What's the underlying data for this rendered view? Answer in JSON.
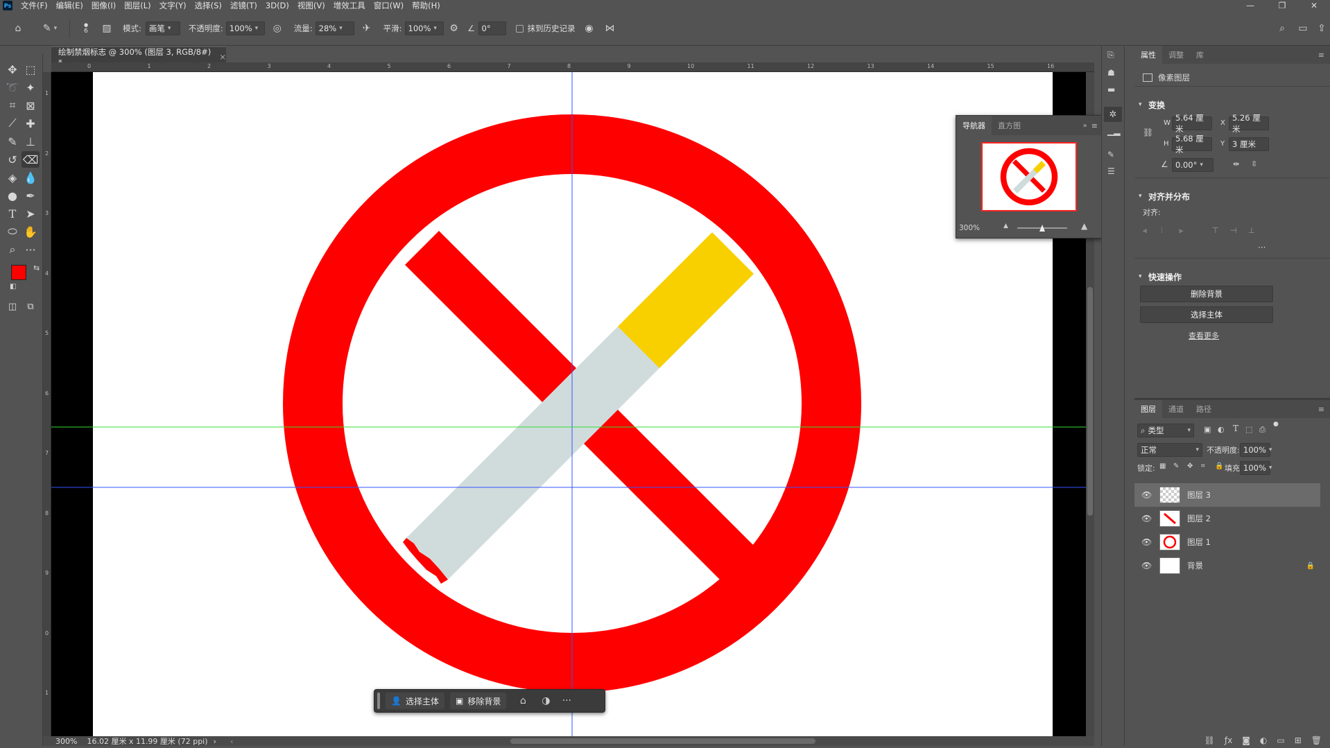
{
  "app": {
    "logo": "Ps"
  },
  "menu": [
    "文件(F)",
    "编辑(E)",
    "图像(I)",
    "图层(L)",
    "文字(Y)",
    "选择(S)",
    "滤镜(T)",
    "3D(D)",
    "视图(V)",
    "增效工具",
    "窗口(W)",
    "帮助(H)"
  ],
  "options": {
    "brush_size": "6",
    "mode_label": "模式:",
    "mode_value": "画笔",
    "opacity_label": "不透明度:",
    "opacity_value": "100%",
    "flow_label": "流量:",
    "flow_value": "28%",
    "smooth_label": "平滑:",
    "smooth_value": "100%",
    "angle_value": "0°",
    "erase_history_label": "抹到历史记录"
  },
  "document": {
    "tab_title": "绘制禁烟标志 @ 300% (图层 3, RGB/8#) *",
    "close_glyph": "×",
    "ruler_top": [
      "0",
      "1",
      "2",
      "3",
      "4",
      "5",
      "6",
      "7",
      "8",
      "9",
      "10",
      "11",
      "12",
      "13",
      "14",
      "15",
      "16"
    ],
    "ruler_left": [
      "1",
      "2",
      "3",
      "4",
      "5",
      "6",
      "7",
      "8",
      "9",
      "0",
      "1"
    ],
    "status_zoom": "300%",
    "status_info": "16.02 厘米 x 11.99 厘米 (72 ppi)",
    "status_arrow": "›"
  },
  "colors": {
    "foreground": "#ff0000",
    "background": "#f8d000",
    "sign_red": "#ff0000",
    "filter_yellow": "#f8d000",
    "cigarette_body": "#d0dcdc",
    "guide_blue": "#3355ff",
    "guide_green": "#33dd33"
  },
  "navigator": {
    "tab_navigator": "导航器",
    "tab_histogram": "直方图",
    "zoom": "300%",
    "zoom_fraction": 0.5
  },
  "context_bar": {
    "select_subject": "选择主体",
    "remove_bg": "移除背景",
    "more": "···"
  },
  "properties": {
    "tabs": [
      "属性",
      "调整",
      "库"
    ],
    "layer_kind": "像素图层",
    "transform_title": "变换",
    "w_label": "W",
    "w_value": "5.64 厘米",
    "x_label": "X",
    "x_value": "5.26 厘米",
    "h_label": "H",
    "h_value": "5.68 厘米",
    "y_label": "Y",
    "y_value": "3 厘米",
    "angle_value": "0.00°",
    "align_title": "对齐并分布",
    "align_label": "对齐:",
    "more_dots": "···",
    "quick_title": "快速操作",
    "remove_bg_btn": "删除背景",
    "select_subject_btn": "选择主体",
    "learn_more": "查看更多"
  },
  "layers_panel": {
    "tabs": [
      "图层",
      "通道",
      "路径"
    ],
    "filter_kind": "类型",
    "blend_mode": "正常",
    "opacity_label": "不透明度:",
    "opacity_value": "100%",
    "lock_label": "锁定:",
    "fill_label": "填充:",
    "fill_value": "100%",
    "layers": [
      {
        "name": "图层 3",
        "selected": true
      },
      {
        "name": "图层 2",
        "selected": false
      },
      {
        "name": "图层 1",
        "selected": false
      },
      {
        "name": "背景",
        "selected": false
      }
    ]
  }
}
